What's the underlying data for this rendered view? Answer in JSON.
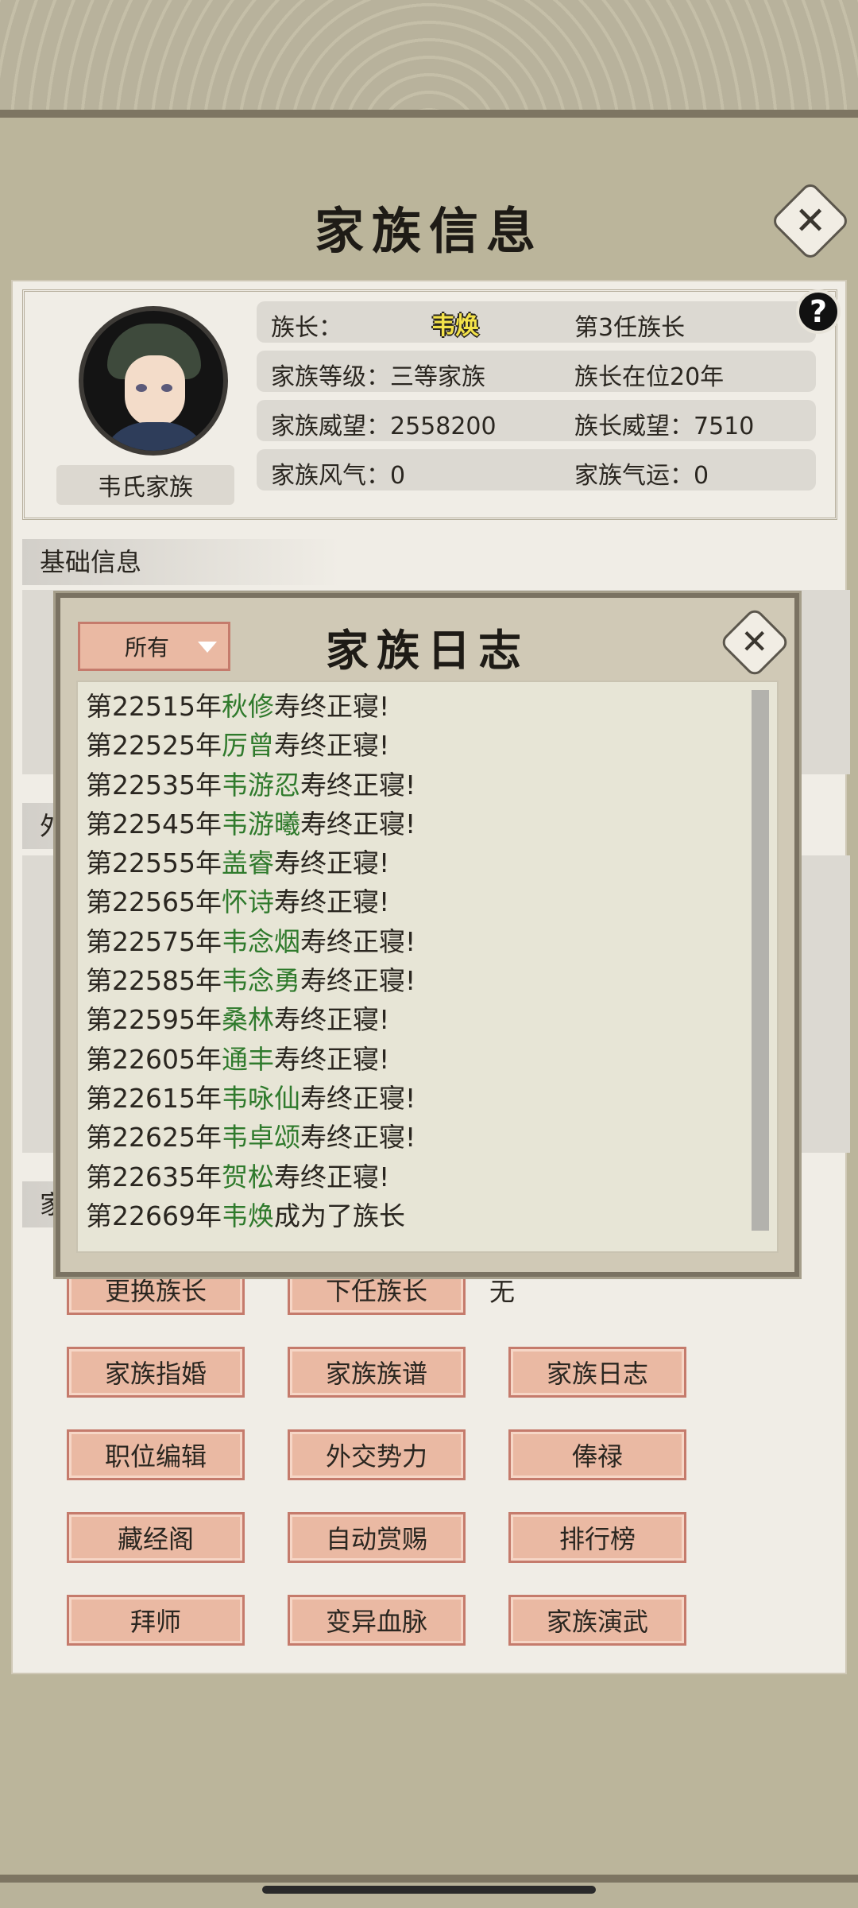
{
  "header": {
    "title": "家族信息"
  },
  "profile": {
    "family_name": "韦氏家族",
    "rows": [
      {
        "left": "族长：",
        "leader": "韦焕",
        "right": "第3任族长"
      },
      {
        "left": "家族等级：三等家族",
        "right": "族长在位20年"
      },
      {
        "left": "家族威望：2558200",
        "right": "族长威望：7510"
      },
      {
        "left": "家族风气：0",
        "right": "家族气运：0"
      }
    ],
    "help_label": "?"
  },
  "sections": {
    "basic": "基础信息",
    "foreign_partial": "外",
    "family_partial": "家"
  },
  "buttons": {
    "change_leader": "更换族长",
    "next_leader": "下任族长",
    "next_leader_value": "无",
    "marriage": "家族指婚",
    "genealogy": "家族族谱",
    "journal": "家族日志",
    "position_edit": "职位编辑",
    "diplomacy": "外交势力",
    "salary": "俸禄",
    "library": "藏经阁",
    "auto_reward": "自动赏赐",
    "ranking": "排行榜",
    "apprentice": "拜师",
    "mutant_blood": "变异血脉",
    "martial_show": "家族演武"
  },
  "log": {
    "title": "家族日志",
    "filter": "所有",
    "entries": [
      {
        "year": "第22515年",
        "name": "秋修",
        "event": "寿终正寝!"
      },
      {
        "year": "第22525年",
        "name": "厉曾",
        "event": "寿终正寝!"
      },
      {
        "year": "第22535年",
        "name": "韦游忍",
        "event": "寿终正寝!"
      },
      {
        "year": "第22545年",
        "name": "韦游曦",
        "event": "寿终正寝!"
      },
      {
        "year": "第22555年",
        "name": "盖睿",
        "event": "寿终正寝!"
      },
      {
        "year": "第22565年",
        "name": "怀诗",
        "event": "寿终正寝!"
      },
      {
        "year": "第22575年",
        "name": "韦念烟",
        "event": "寿终正寝!"
      },
      {
        "year": "第22585年",
        "name": "韦念勇",
        "event": "寿终正寝!"
      },
      {
        "year": "第22595年",
        "name": "桑林",
        "event": "寿终正寝!"
      },
      {
        "year": "第22605年",
        "name": "通丰",
        "event": "寿终正寝!"
      },
      {
        "year": "第22615年",
        "name": "韦咏仙",
        "event": "寿终正寝!"
      },
      {
        "year": "第22625年",
        "name": "韦卓颂",
        "event": "寿终正寝!"
      },
      {
        "year": "第22635年",
        "name": "贺松",
        "event": "寿终正寝!"
      },
      {
        "year": "第22669年",
        "name": "韦焕",
        "event": "成为了族长"
      }
    ]
  },
  "icons": {
    "close": "close-icon",
    "dropdown": "chevron-down-icon",
    "help": "help-icon"
  }
}
